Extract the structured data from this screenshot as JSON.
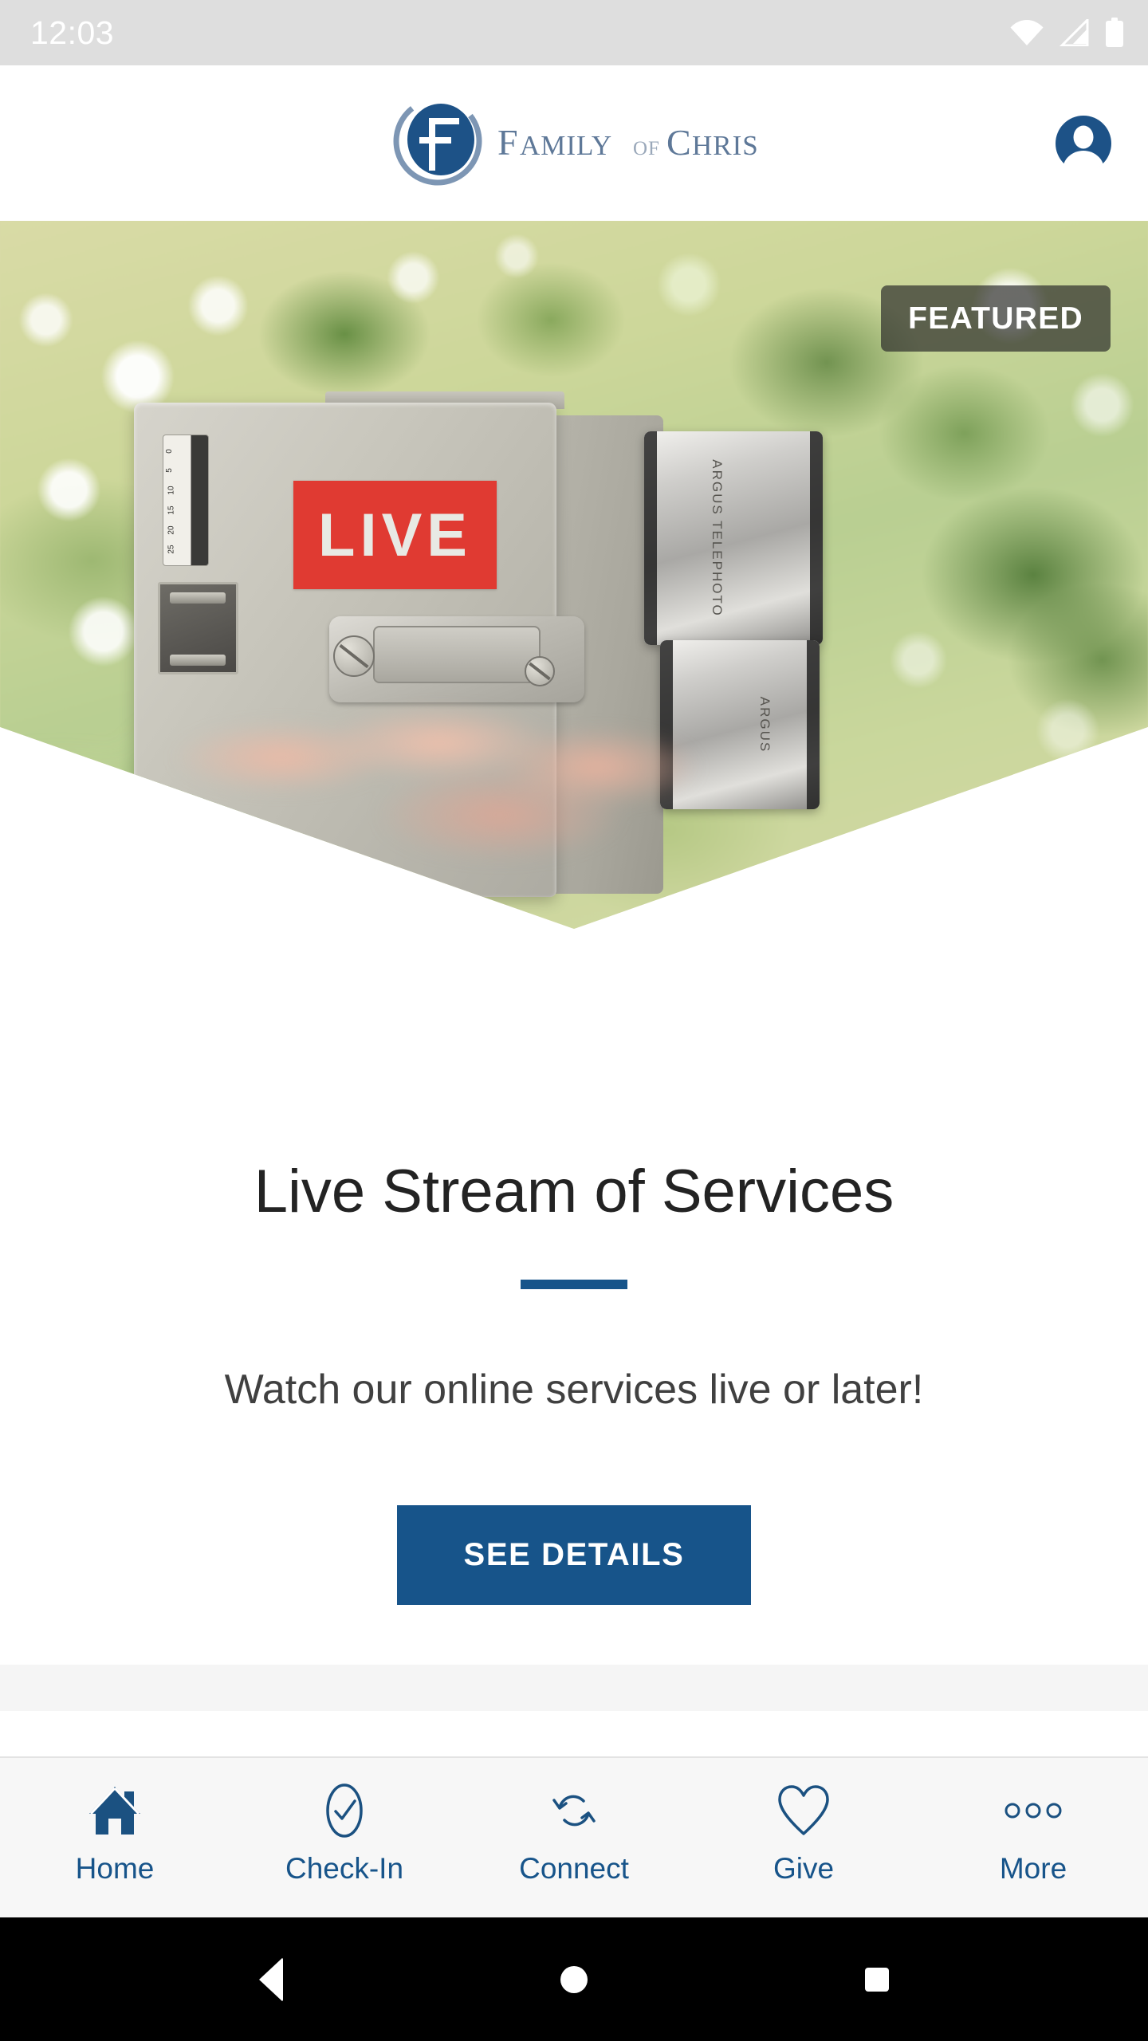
{
  "status_bar": {
    "clock": "12:03",
    "icons": [
      "wifi-icon",
      "cellular-signal-icon",
      "battery-icon"
    ]
  },
  "header": {
    "logo_icon": "family-of-christ-logo",
    "brand_line1": "FAMILY",
    "brand_of": "of",
    "brand_line2": "CHRIST",
    "profile_icon": "account-avatar-icon"
  },
  "hero": {
    "badge_label": "FEATURED",
    "photo_alt": "vintage-argus-camera-with-live-sticker",
    "photo_live_sticker": "LIVE",
    "photo_lens_label_telephoto": "ARGUS TELEPHOTO",
    "photo_lens_label_standard": "ARGUS",
    "photo_counter_ticks": [
      "0",
      "5",
      "10",
      "15",
      "20",
      "25"
    ]
  },
  "feature": {
    "title": "Live Stream of Services",
    "subtitle": "Watch our online services live or later!",
    "button_label": "SEE DETAILS"
  },
  "tab_bar": {
    "items": [
      {
        "label": "Home",
        "icon": "home-icon",
        "active": true
      },
      {
        "label": "Check-In",
        "icon": "check-circle-icon",
        "active": false
      },
      {
        "label": "Connect",
        "icon": "refresh-arrows-icon",
        "active": false
      },
      {
        "label": "Give",
        "icon": "heart-icon",
        "active": false
      },
      {
        "label": "More",
        "icon": "ellipsis-icon",
        "active": false
      }
    ]
  },
  "system_nav": {
    "back_icon": "android-back-icon",
    "home_icon": "android-home-icon",
    "recents_icon": "android-recents-icon"
  },
  "colors": {
    "brand_blue": "#17548a",
    "status_bar_bg": "#dedede",
    "tab_bar_bg": "#f7f7f7",
    "title_text": "#232323",
    "live_sticker_red": "#e03a32"
  }
}
